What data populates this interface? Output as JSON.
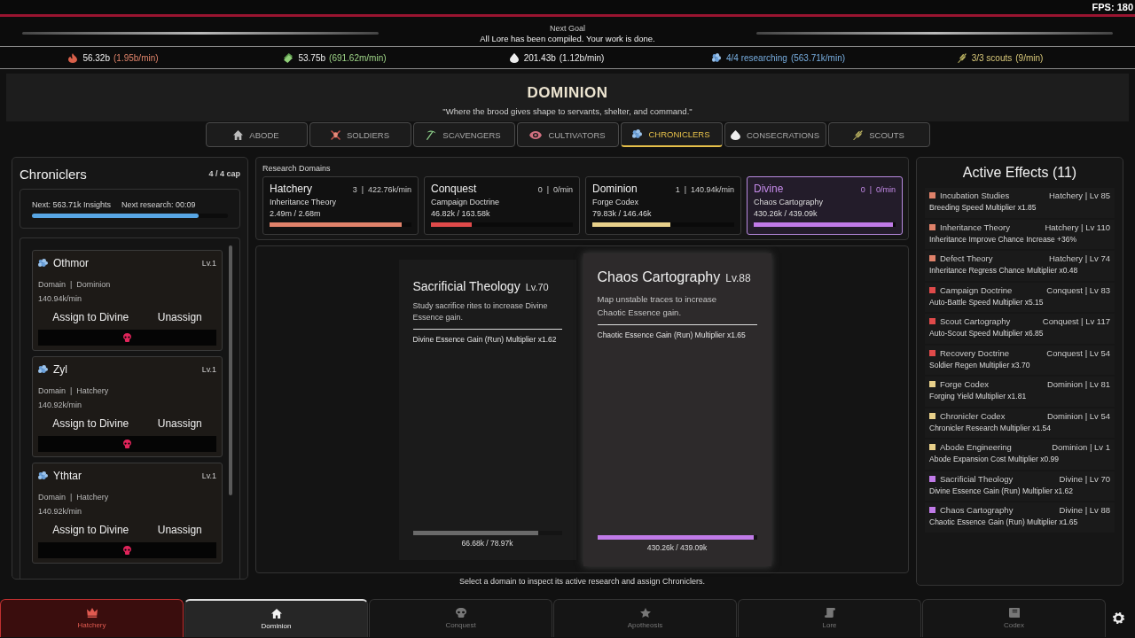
{
  "fps": "FPS: 180",
  "goal": {
    "label": "Next Goal",
    "text": "All Lore has been compiled. Your work is done."
  },
  "resources": [
    {
      "value": "56.32b",
      "rate": "(1.95b/min)"
    },
    {
      "value": "53.75b",
      "rate": "(691.62m/min)"
    },
    {
      "value": "201.43b",
      "rate": "(1.12b/min)"
    },
    {
      "value": "4/4 researching",
      "rate": "(563.71k/min)"
    },
    {
      "value": "3/3 scouts",
      "rate": "(9/min)"
    }
  ],
  "header": {
    "title": "DOMINION",
    "quote": "\"Where the brood gives shape to servants, shelter, and command.\""
  },
  "tabs": [
    {
      "label": "ABODE",
      "selected": false
    },
    {
      "label": "SOLDIERS",
      "selected": false
    },
    {
      "label": "SCAVENGERS",
      "selected": false
    },
    {
      "label": "CULTIVATORS",
      "selected": false
    },
    {
      "label": "CHRONICLERS",
      "selected": true
    },
    {
      "label": "CONSECRATIONS",
      "selected": false
    },
    {
      "label": "SCOUTS",
      "selected": false
    }
  ],
  "chroniclers": {
    "title": "Chroniclers",
    "cap": "4 / 4 cap",
    "next": "Next: 563.71k Insights",
    "timer": "Next research: 00:09",
    "level": 0.85,
    "list": [
      {
        "name": "Othmor",
        "lv": "Lv.1",
        "domain": "Domain  |  Dominion",
        "rate": "140.94k/min",
        "assign": "Assign to Divine",
        "unassign": "Unassign"
      },
      {
        "name": "Zyl",
        "lv": "Lv.1",
        "domain": "Domain  |  Hatchery",
        "rate": "140.92k/min",
        "assign": "Assign to Divine",
        "unassign": "Unassign"
      },
      {
        "name": "Ythtar",
        "lv": "Lv.1",
        "domain": "Domain  |  Hatchery",
        "rate": "140.92k/min",
        "assign": "Assign to Divine",
        "unassign": "Unassign"
      }
    ]
  },
  "domains": {
    "title": "Research Domains",
    "items": [
      {
        "name": "Hatchery",
        "stats": "3  |  422.76k/min",
        "research": "Inheritance Theory",
        "progress": "2.49m / 2.68m",
        "level": 0.93,
        "color": "#e0826a",
        "selected": false
      },
      {
        "name": "Conquest",
        "stats": "0  |  0/min",
        "research": "Campaign Doctrine",
        "progress": "46.82k / 163.58k",
        "level": 0.29,
        "color": "#e04a4a",
        "selected": false
      },
      {
        "name": "Dominion",
        "stats": "1  |  140.94k/min",
        "research": "Forge Codex",
        "progress": "79.83k / 146.46k",
        "level": 0.55,
        "color": "#e8d08a",
        "selected": false
      },
      {
        "name": "Divine",
        "stats": "0  |  0/min",
        "research": "Chaos Cartography",
        "progress": "430.26k / 439.09k",
        "level": 0.98,
        "color": "#c07ae8",
        "selected": true
      }
    ]
  },
  "research": {
    "cards": [
      {
        "title": "Sacrificial Theology",
        "lv": "Lv.70",
        "description": "Study sacrifice rites to increase Divine Essence gain.",
        "effect": "Divine Essence Gain (Run) Multiplier x1.62",
        "progress": "66.68k / 78.97k",
        "level": 0.84,
        "active": false
      },
      {
        "title": "Chaos Cartography",
        "lv": "Lv.88",
        "description": "Map unstable traces to increase Chaotic Essence gain.",
        "effect": "Chaotic Essence Gain (Run) Multiplier x1.65",
        "progress": "430.26k / 439.09k",
        "level": 0.98,
        "active": true
      }
    ],
    "hint": "Select a domain to inspect its active research and assign Chroniclers."
  },
  "effects": {
    "title": "Active Effects (11)",
    "items": [
      {
        "name": "Incubation Studies",
        "source": "Hatchery | Lv 85",
        "description": "Breeding Speed Multiplier x1.85",
        "color": "#e0826a"
      },
      {
        "name": "Inheritance Theory",
        "source": "Hatchery | Lv 110",
        "description": "Inheritance Improve Chance Increase +36%",
        "color": "#e0826a"
      },
      {
        "name": "Defect Theory",
        "source": "Hatchery | Lv 74",
        "description": "Inheritance Regress Chance Multiplier x0.48",
        "color": "#e0826a"
      },
      {
        "name": "Campaign Doctrine",
        "source": "Conquest | Lv 83",
        "description": "Auto-Battle Speed Multiplier x5.15",
        "color": "#e04a4a"
      },
      {
        "name": "Scout Cartography",
        "source": "Conquest | Lv 117",
        "description": "Auto-Scout Speed Multiplier x6.85",
        "color": "#e04a4a"
      },
      {
        "name": "Recovery Doctrine",
        "source": "Conquest | Lv 54",
        "description": "Soldier Regen Multiplier x3.70",
        "color": "#e04a4a"
      },
      {
        "name": "Forge Codex",
        "source": "Dominion | Lv 81",
        "description": "Forging Yield Multiplier x1.81",
        "color": "#e8d08a"
      },
      {
        "name": "Chronicler Codex",
        "source": "Dominion | Lv 54",
        "description": "Chronicler Research Multiplier x1.54",
        "color": "#e8d08a"
      },
      {
        "name": "Abode Engineering",
        "source": "Dominion | Lv 1",
        "description": "Abode Expansion Cost Multiplier x0.99",
        "color": "#e8d08a"
      },
      {
        "name": "Sacrificial Theology",
        "source": "Divine | Lv 70",
        "description": "Divine Essence Gain (Run) Multiplier x1.62",
        "color": "#c07ae8"
      },
      {
        "name": "Chaos Cartography",
        "source": "Divine | Lv 88",
        "description": "Chaotic Essence Gain (Run) Multiplier x1.65",
        "color": "#c07ae8"
      }
    ]
  },
  "nav": [
    {
      "label": "Hatchery",
      "selected": false,
      "alert": true
    },
    {
      "label": "Dominion",
      "selected": true,
      "alert": false
    },
    {
      "label": "Conquest",
      "selected": false,
      "alert": false
    },
    {
      "label": "Apotheosis",
      "selected": false,
      "alert": false
    },
    {
      "label": "Lore",
      "selected": false,
      "alert": false
    },
    {
      "label": "Codex",
      "selected": false,
      "alert": false
    }
  ]
}
